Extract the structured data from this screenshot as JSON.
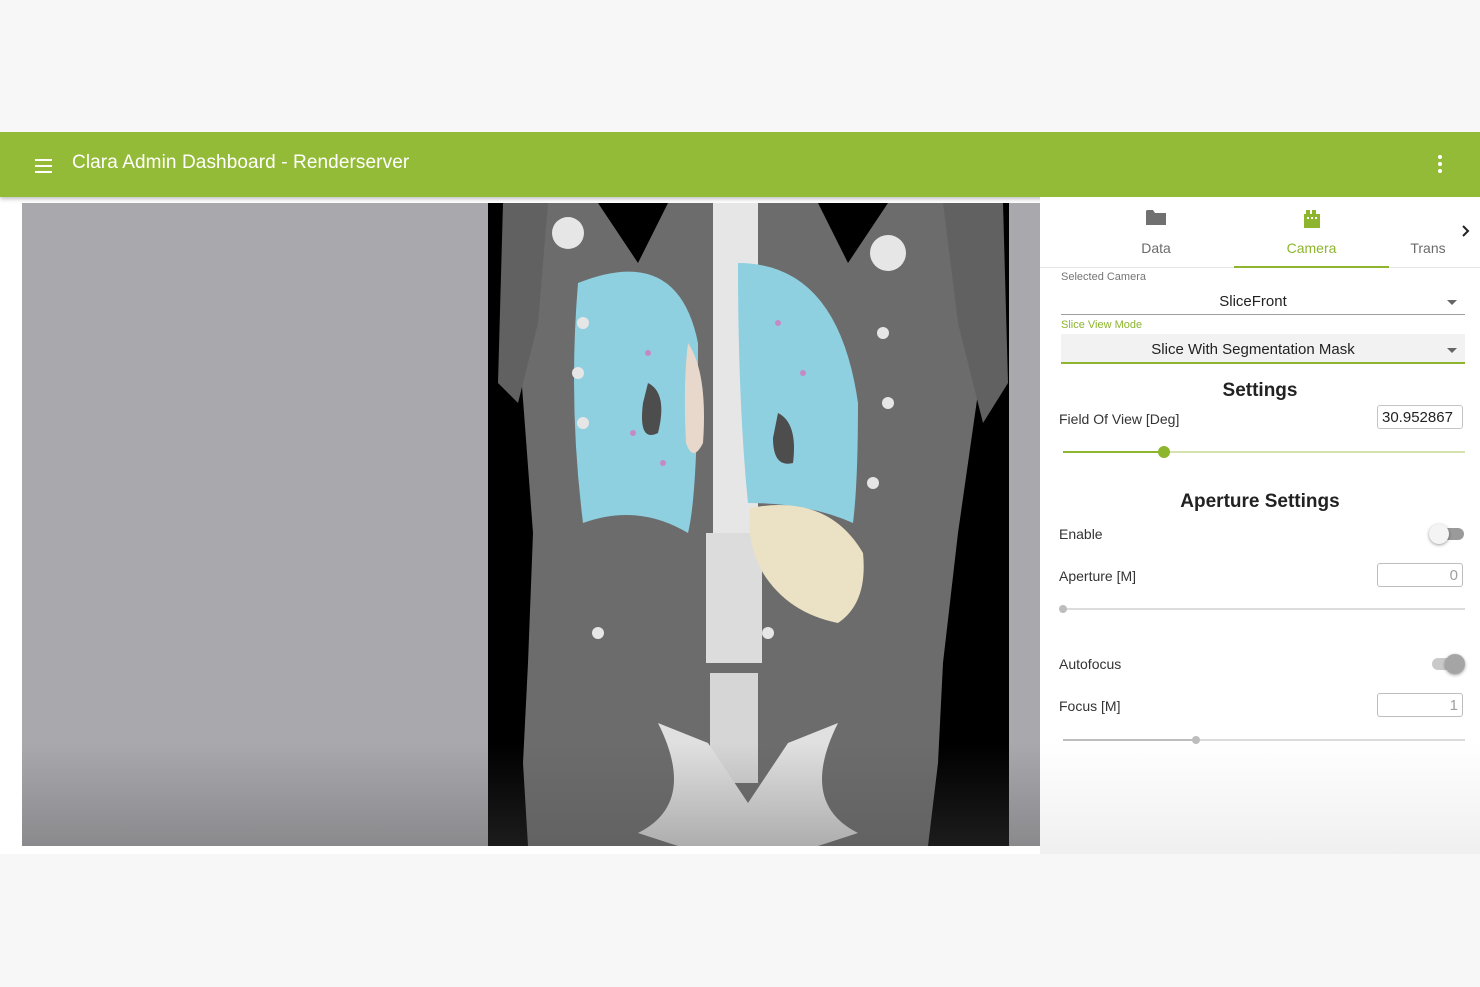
{
  "app": {
    "title": "Clara Admin Dashboard - Renderserver",
    "accent": "#94bb38"
  },
  "toolbar": {
    "menu_icon": "hamburger-menu-icon",
    "more_icon": "more-vert-icon"
  },
  "viewport": {
    "content": "CT coronal slice with segmentation mask overlay"
  },
  "tabs": [
    {
      "label": "Data",
      "icon": "folder-icon",
      "active": false
    },
    {
      "label": "Camera",
      "icon": "camera-reel-icon",
      "active": true
    },
    {
      "label": "Trans",
      "icon": "",
      "active": false
    }
  ],
  "camera": {
    "selected_camera_label": "Selected Camera",
    "selected_camera_value": "SliceFront",
    "slice_view_mode_label": "Slice View Mode",
    "slice_view_mode_value": "Slice With Segmentation Mask"
  },
  "settings": {
    "heading": "Settings",
    "fov_label": "Field Of View [Deg]",
    "fov_value": "30.952867",
    "fov_slider_fraction": 0.25
  },
  "aperture": {
    "heading": "Aperture Settings",
    "enable_label": "Enable",
    "enable_on": false,
    "aperture_label": "Aperture [M]",
    "aperture_value": "0",
    "aperture_slider_fraction": 0.0,
    "autofocus_label": "Autofocus",
    "autofocus_on": true,
    "focus_label": "Focus [M]",
    "focus_value": "1",
    "focus_slider_fraction": 0.33
  }
}
